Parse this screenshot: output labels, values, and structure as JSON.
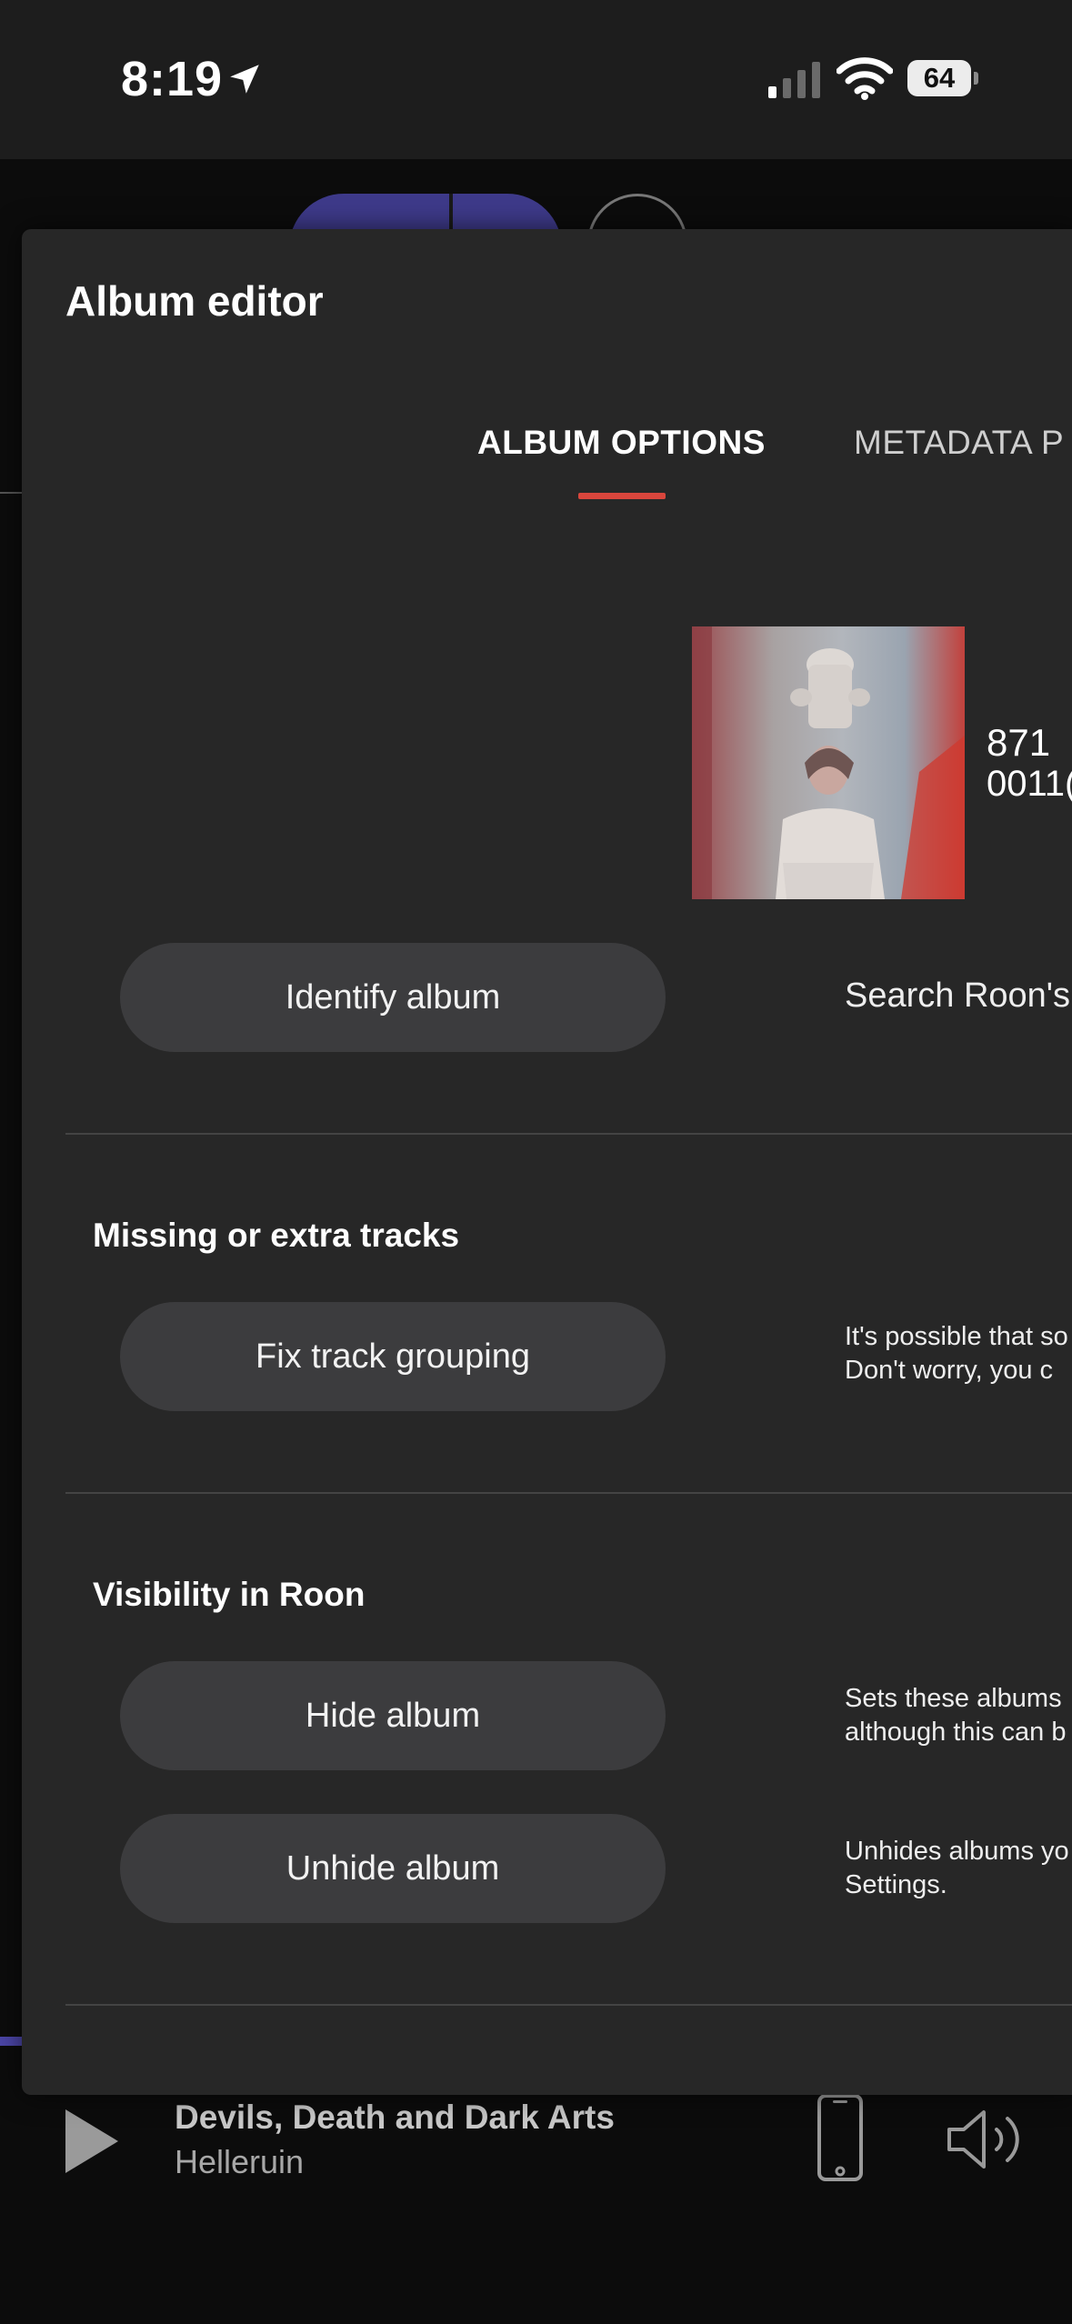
{
  "status_bar": {
    "time": "8:19",
    "battery": "64",
    "icons": [
      "location-arrow-icon",
      "cellular-signal-icon",
      "wifi-icon",
      "battery-icon"
    ]
  },
  "dialog": {
    "title": "Album editor",
    "tabs": [
      {
        "label": "ALBUM OPTIONS",
        "active": true
      },
      {
        "label": "METADATA P",
        "active": false
      }
    ],
    "accent_color": "#d9463c",
    "album_cover": {
      "id_line1": "871",
      "id_line2": "0011("
    },
    "identify": {
      "button_label": "Identify album",
      "description": "Search Roon's"
    },
    "missing_tracks": {
      "heading": "Missing or extra tracks",
      "button_label": "Fix track grouping",
      "description_line1": "It's possible that so",
      "description_line2": "Don't worry, you c"
    },
    "visibility": {
      "heading": "Visibility in Roon",
      "hide_button_label": "Hide album",
      "hide_description_line1": "Sets these albums",
      "hide_description_line2": "although this can b",
      "unhide_button_label": "Unhide album",
      "unhide_description_line1": "Unhides albums yo",
      "unhide_description_line2": "Settings."
    }
  },
  "now_playing": {
    "title": "Devils, Death and Dark Arts",
    "artist": "Helleruin",
    "icons": [
      "play-icon",
      "phone-icon",
      "volume-icon"
    ]
  },
  "background_app": {
    "accent_color": "#3e3a8a"
  }
}
